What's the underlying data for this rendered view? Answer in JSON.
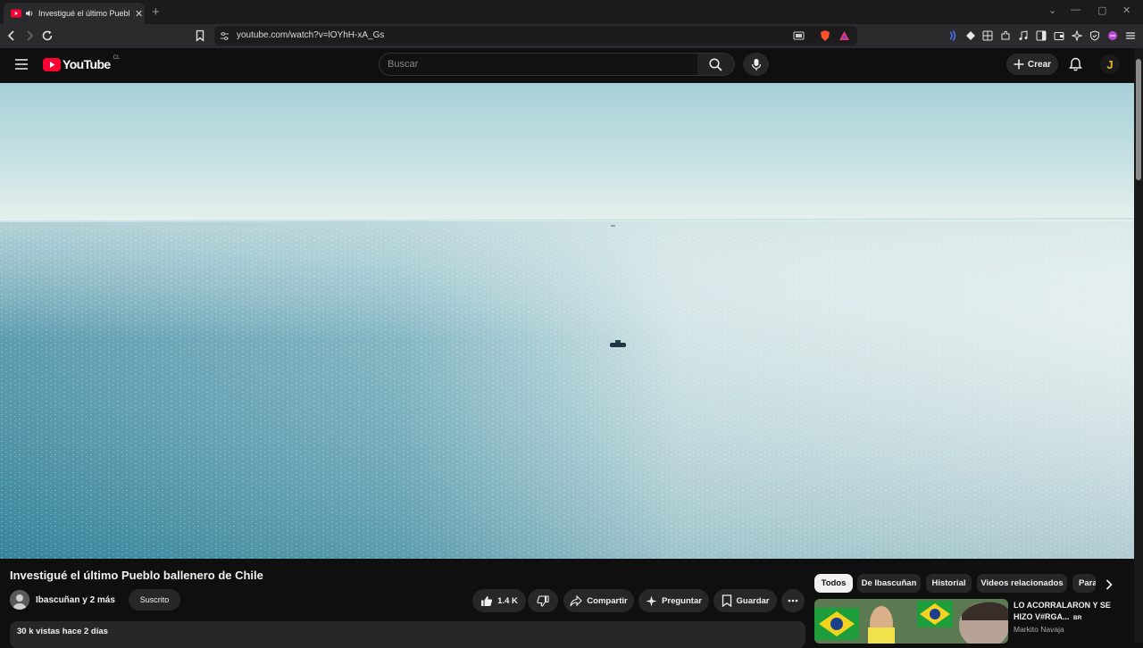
{
  "browser": {
    "tab_title": "Investigué el último Pueblo ballenero de Chile",
    "new_tab_symbol": "+",
    "url": "youtube.com/watch?v=lOYhH-xA_Gs"
  },
  "header": {
    "logo_text": "YouTube",
    "country_code": "CL",
    "search_placeholder": "Buscar",
    "create_label": "Crear",
    "avatar_letter": "J"
  },
  "video": {
    "title": "Investigué el último Pueblo ballenero de Chile",
    "channel": "Ibascuñan y 2 más",
    "subscribe_label": "Suscrito",
    "likes": "1.4 K",
    "share_label": "Compartir",
    "ask_label": "Preguntar",
    "save_label": "Guardar",
    "views_date": "30 k vistas  hace 2 días"
  },
  "chips": [
    "Todos",
    "De Ibascuñan",
    "Historial",
    "Videos relacionados",
    "Para ti"
  ],
  "recommended": [
    {
      "title": "LO ACORRALARON Y SE HIZO V#RGA...",
      "badge": "BR",
      "channel": "Markito Navaja"
    }
  ],
  "colors": {
    "youtube_red": "#ff0033",
    "background": "#0f0f0f",
    "chip_bg": "#272727"
  },
  "icons": {
    "menu": "hamburger-icon",
    "search": "search-icon",
    "mic": "mic-icon",
    "notifications": "bell-icon",
    "like": "thumbs-up-icon",
    "dislike": "thumbs-down-icon",
    "share": "share-icon",
    "ask": "sparkle-icon",
    "save": "bookmark-icon",
    "more": "more-horiz-icon"
  }
}
